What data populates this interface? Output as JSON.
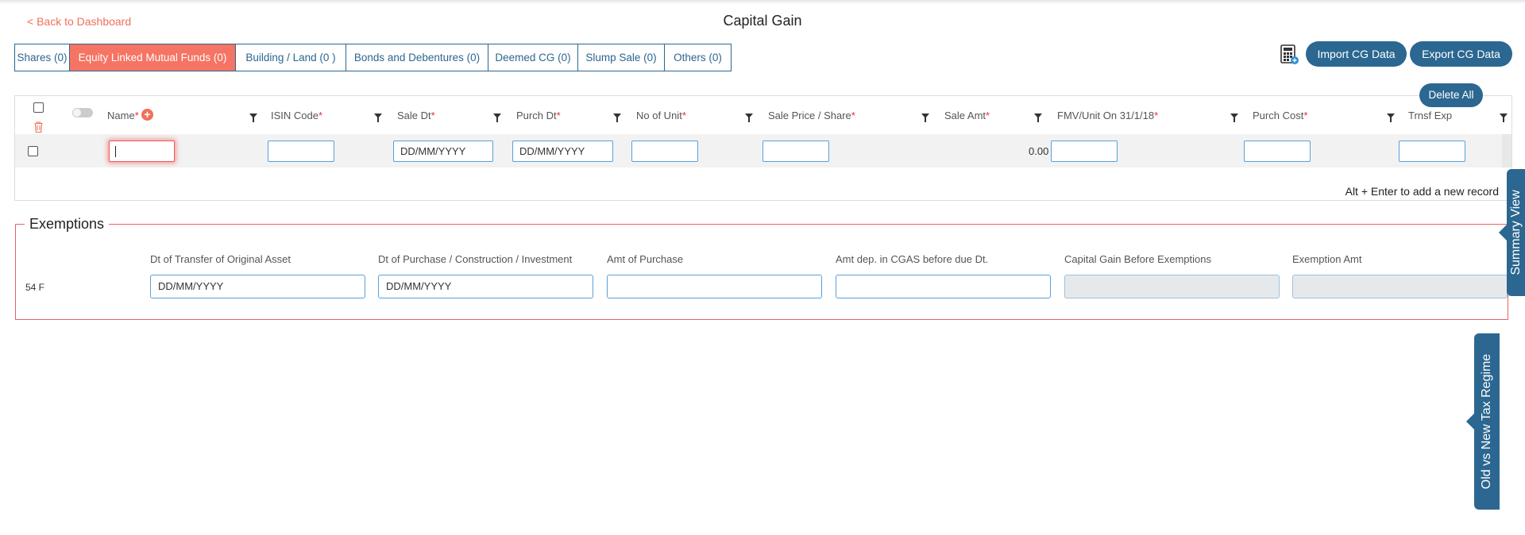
{
  "header": {
    "back_link": "< Back to Dashboard",
    "title": "Capital Gain"
  },
  "tabs": [
    {
      "label": "Shares (0)",
      "active": false
    },
    {
      "label": "Equity Linked Mutual Funds (0)",
      "active": true
    },
    {
      "label": "Building / Land (0 )",
      "active": false
    },
    {
      "label": "Bonds and Debentures (0)",
      "active": false
    },
    {
      "label": "Deemed CG (0)",
      "active": false
    },
    {
      "label": "Slump Sale (0)",
      "active": false
    },
    {
      "label": "Others (0)",
      "active": false
    }
  ],
  "toolbar": {
    "calculator_icon": "calculator-icon",
    "import_label": "Import CG Data",
    "export_label": "Export CG Data",
    "delete_all_label": "Delete All"
  },
  "grid": {
    "columns": [
      {
        "label": "Name",
        "required": "*"
      },
      {
        "label": "ISIN Code",
        "required": "*"
      },
      {
        "label": "Sale Dt",
        "required": "*"
      },
      {
        "label": "Purch Dt",
        "required": "*"
      },
      {
        "label": "No of Unit",
        "required": "*"
      },
      {
        "label": "Sale Price / Share",
        "required": "*"
      },
      {
        "label": "Sale Amt",
        "required": "*"
      },
      {
        "label": "FMV/Unit On 31/1/18",
        "required": "*"
      },
      {
        "label": "Purch Cost",
        "required": "*"
      },
      {
        "label": "Trnsf Exp",
        "required": ""
      }
    ],
    "row": {
      "name": "",
      "isin": "",
      "sale_dt": "DD/MM/YYYY",
      "purch_dt": "DD/MM/YYYY",
      "no_of_unit": "",
      "sale_price": "",
      "sale_amt": "0.00",
      "fmv": "",
      "purch_cost": "",
      "trnsf_exp": ""
    },
    "hint": "Alt + Enter to add a new record"
  },
  "exemptions": {
    "title": "Exemptions",
    "row_label": "54 F",
    "fields": [
      {
        "label": "Dt of Transfer of Original Asset",
        "value": "DD/MM/YYYY",
        "readonly": false
      },
      {
        "label": "Dt of Purchase / Construction / Investment",
        "value": "DD/MM/YYYY",
        "readonly": false
      },
      {
        "label": "Amt of Purchase",
        "value": "",
        "readonly": false
      },
      {
        "label": "Amt dep. in CGAS before due Dt.",
        "value": "",
        "readonly": false
      },
      {
        "label": "Capital Gain Before Exemptions",
        "value": "",
        "readonly": true
      },
      {
        "label": "Exemption Amt",
        "value": "",
        "readonly": true
      }
    ]
  },
  "side_tabs": {
    "summary": "Summary View",
    "regime": "Old vs New Tax Regime"
  },
  "colors": {
    "primary": "#2b6790",
    "accent": "#f57463",
    "required": "#e0303a"
  }
}
